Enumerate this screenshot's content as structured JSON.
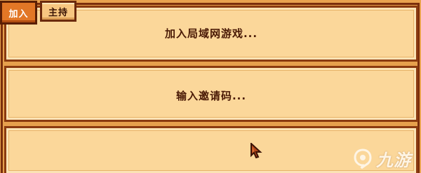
{
  "tabs": [
    {
      "label": "加入",
      "active": true
    },
    {
      "label": "主持",
      "active": false
    }
  ],
  "options": [
    {
      "label": "加入局域网游戏..."
    },
    {
      "label": "输入邀请码..."
    },
    {
      "label": ""
    }
  ],
  "watermark": {
    "text": "九游",
    "icon": "jiuyou-logo-icon"
  },
  "colors": {
    "tab_active": "#e27726",
    "tab_inactive": "#f7c680",
    "panel_bg": "#fbd79a",
    "border_dark": "#8a3a10",
    "text": "#4a1a06"
  }
}
